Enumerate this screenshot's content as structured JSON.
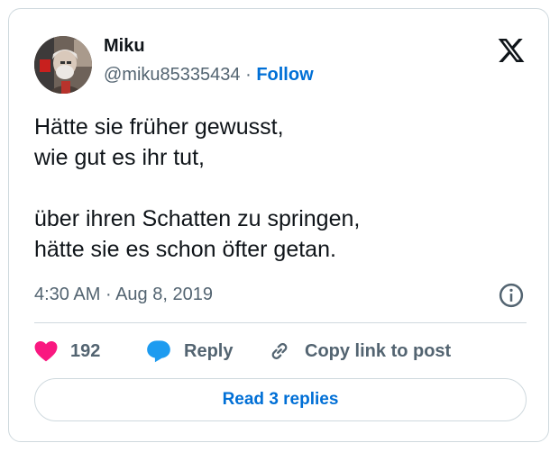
{
  "tweet": {
    "author": {
      "name": "Miku",
      "handle": "@miku85335434",
      "separator": "·",
      "follow_label": "Follow"
    },
    "text_lines": [
      "Hätte sie früher gewusst,",
      "wie gut es ihr tut,",
      "über ihren Schatten zu springen,",
      "hätte sie es schon öfter getan."
    ],
    "meta": {
      "time": "4:30 AM",
      "separator": "·",
      "date": "Aug 8, 2019"
    },
    "actions": {
      "like_count": "192",
      "reply_label": "Reply",
      "copy_label": "Copy link to post"
    },
    "read_replies_label": "Read 3 replies"
  },
  "icons": {
    "brand": "x-logo-icon",
    "info": "info-icon",
    "like": "heart-icon",
    "reply": "speech-bubble-icon",
    "copy": "link-icon"
  },
  "colors": {
    "heart": "#f91880",
    "reply_bubble": "#1d9bf0",
    "link_blue": "#006fd6",
    "secondary_text": "#536471",
    "border": "#cfd9de"
  }
}
